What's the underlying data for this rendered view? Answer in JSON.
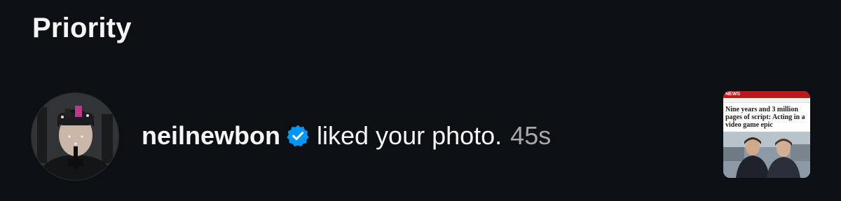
{
  "section": {
    "title": "Priority"
  },
  "notification": {
    "username": "neilnewbon",
    "verified_icon": "verified-badge-icon",
    "action": "liked your photo.",
    "time": "45s",
    "thumbnail": {
      "brand": "NEWS",
      "headline": "Nine years and 3 million pages of script: Acting in a video game epic"
    }
  },
  "colors": {
    "background": "#0c1014",
    "text": "#f5f5f5",
    "muted": "#a8a8a8",
    "verified": "#0095f6",
    "news_red": "#bb1919"
  }
}
